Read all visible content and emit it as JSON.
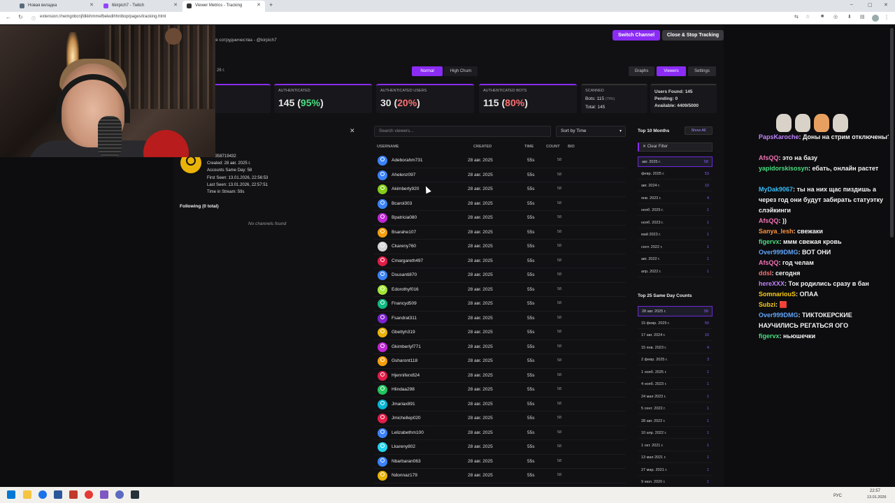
{
  "browser": {
    "tabs": [
      {
        "label": "Новая вкладка",
        "color": "#5a6a7a"
      },
      {
        "label": "6kirpich7 - Twitch",
        "color": "#9146ff"
      },
      {
        "label": "Viewer Metrics - Tracking",
        "color": "#333333"
      }
    ],
    "url": "extension://nemgnbcnjfdkkhmmefbeledihhnlbop/pages/tracking.html"
  },
  "header": {
    "channel_name": "6kirpich7",
    "channel_sub": "я сотрудничества - @kirpich7",
    "switch_label": "Switch Channel",
    "stop_label": "Close & Stop Tracking"
  },
  "toggles": {
    "normal": "Normal",
    "high_churn": "High Churn",
    "graphs": "Graphs",
    "viewers": "Viewers",
    "settings": "Settings",
    "left_truncated": "26 г."
  },
  "stats": {
    "authenticated": {
      "title": "AUTHENTICATED",
      "value": "145",
      "pct": "95%"
    },
    "auth_users": {
      "title": "AUTHENTICATED USERS",
      "value": "30",
      "pct": "20%"
    },
    "auth_bots": {
      "title": "AUTHENTICATED BOTS",
      "value": "115",
      "pct": "80%"
    },
    "scanned": {
      "title": "SCANNED",
      "bots": "Bots: 115",
      "bots_pct": "(79%)",
      "total": "Total: 145"
    },
    "users": {
      "found": "Users Found: 145",
      "pending": "Pending: 0",
      "available": "Available: 4409/5000"
    }
  },
  "detail": {
    "id": "Id: 1358719432",
    "created": "Created: 28 авг. 2025 г.",
    "same_day": "Accounts Same Day: 58",
    "first_seen": "First Seen: 13.01.2026, 22:56:53",
    "last_seen": "Last Seen: 13.01.2026, 22:57:51",
    "time_in_stream": "Time in Stream: 59s",
    "following": "Following (0 total)",
    "no_channels": "No channels found"
  },
  "viewers": {
    "search_placeholder": "Search viewers...",
    "sort_label": "Sort by Time",
    "columns": {
      "username": "USERNAME",
      "created": "CREATED",
      "time": "TIME",
      "count": "COUNT",
      "bio": "BIO"
    },
    "rows": [
      {
        "username": "Adeborahm731",
        "created": "28 авг. 2025",
        "time": "55s",
        "count": "58",
        "color": "#3b82f6"
      },
      {
        "username": "Ahelenz097",
        "created": "28 авг. 2025",
        "time": "55s",
        "count": "58",
        "color": "#3b82f6"
      },
      {
        "username": "Akimberly920",
        "created": "28 авг. 2025",
        "time": "55s",
        "count": "58",
        "color": "#84cc16"
      },
      {
        "username": "Bcarol303",
        "created": "28 авг. 2025",
        "time": "55s",
        "count": "58",
        "color": "#3b82f6"
      },
      {
        "username": "Bpatricia080",
        "created": "28 авг. 2025",
        "time": "55s",
        "count": "58",
        "color": "#c026d3"
      },
      {
        "username": "Bsarahe107",
        "created": "28 авг. 2025",
        "time": "55s",
        "count": "58",
        "color": "#f59e0b"
      },
      {
        "username": "Ckareny760",
        "created": "28 авг. 2025",
        "time": "55s",
        "count": "58",
        "color": "#d4d4d8"
      },
      {
        "username": "Cmargareth497",
        "created": "28 авг. 2025",
        "time": "55s",
        "count": "58",
        "color": "#e11d48"
      },
      {
        "username": "Dsusanti870",
        "created": "28 авг. 2025",
        "time": "55s",
        "count": "58",
        "color": "#3b82f6"
      },
      {
        "username": "Edorothyf016",
        "created": "28 авг. 2025",
        "time": "55s",
        "count": "58",
        "color": "#a3e635"
      },
      {
        "username": "Fnancyd509",
        "created": "28 авг. 2025",
        "time": "55s",
        "count": "58",
        "color": "#10b981"
      },
      {
        "username": "Fsandrat311",
        "created": "28 авг. 2025",
        "time": "55s",
        "count": "58",
        "color": "#7e22ce"
      },
      {
        "username": "Gbettyh319",
        "created": "28 авг. 2025",
        "time": "55s",
        "count": "58",
        "color": "#eab308"
      },
      {
        "username": "Gkimberlyf771",
        "created": "28 авг. 2025",
        "time": "55s",
        "count": "58",
        "color": "#c026d3"
      },
      {
        "username": "Gsharont118",
        "created": "28 авг. 2025",
        "time": "55s",
        "count": "58",
        "color": "#f59e0b"
      },
      {
        "username": "Hjenniferx824",
        "created": "28 авг. 2025",
        "time": "55s",
        "count": "58",
        "color": "#e11d48"
      },
      {
        "username": "Hlindaa298",
        "created": "28 авг. 2025",
        "time": "55s",
        "count": "58",
        "color": "#22c55e"
      },
      {
        "username": "Jmariax891",
        "created": "28 авг. 2025",
        "time": "55s",
        "count": "58",
        "color": "#06b6d4"
      },
      {
        "username": "Jmichellep020",
        "created": "28 авг. 2025",
        "time": "55s",
        "count": "58",
        "color": "#e11d48"
      },
      {
        "username": "Lelizabethm100",
        "created": "28 авг. 2025",
        "time": "55s",
        "count": "58",
        "color": "#3b82f6"
      },
      {
        "username": "Lkareny802",
        "created": "28 авг. 2025",
        "time": "55s",
        "count": "58",
        "color": "#22d3ee"
      },
      {
        "username": "Nbarbaran063",
        "created": "28 авг. 2025",
        "time": "55s",
        "count": "58",
        "color": "#3b82f6"
      },
      {
        "username": "Ndonnaz179",
        "created": "28 авг. 2025",
        "time": "55s",
        "count": "58",
        "color": "#eab308"
      }
    ]
  },
  "top_months": {
    "title": "Top 10 Months",
    "show_all": "Show All",
    "clear_filter": "✕ Clear Filter",
    "items": [
      {
        "label": "авг. 2025 г.",
        "count": "58",
        "selected": true
      },
      {
        "label": "февр. 2025 г.",
        "count": "53"
      },
      {
        "label": "авг. 2024 г.",
        "count": "10"
      },
      {
        "label": "янв. 2023 г.",
        "count": "4"
      },
      {
        "label": "нояб. 2025 г.",
        "count": "1"
      },
      {
        "label": "нояб. 2023 г.",
        "count": "1"
      },
      {
        "label": "май 2023 г.",
        "count": "1"
      },
      {
        "label": "сент. 2022 г.",
        "count": "1"
      },
      {
        "label": "авг. 2022 г.",
        "count": "1"
      },
      {
        "label": "апр. 2022 г.",
        "count": "1"
      }
    ]
  },
  "top_same_day": {
    "title": "Top 25 Same Day Counts",
    "items": [
      {
        "label": "28 авг. 2025 г.",
        "count": "58",
        "selected": true
      },
      {
        "label": "15 февр. 2025 г.",
        "count": "50"
      },
      {
        "label": "17 авг. 2024 г.",
        "count": "10"
      },
      {
        "label": "15 янв. 2023 г.",
        "count": "4"
      },
      {
        "label": "2 февр. 2025 г.",
        "count": "3"
      },
      {
        "label": "1 нояб. 2025 г.",
        "count": "1"
      },
      {
        "label": "4 нояб. 2023 г.",
        "count": "1"
      },
      {
        "label": "24 мая 2023 г.",
        "count": "1"
      },
      {
        "label": "5 сент. 2022 г.",
        "count": "1"
      },
      {
        "label": "28 авг. 2022 г.",
        "count": "1"
      },
      {
        "label": "10 апр. 2022 г.",
        "count": "1"
      },
      {
        "label": "1 окт. 2021 г.",
        "count": "1"
      },
      {
        "label": "13 мая 2021 г.",
        "count": "1"
      },
      {
        "label": "27 мар. 2021 г.",
        "count": "1"
      },
      {
        "label": "9 июл. 2020 г.",
        "count": "1"
      }
    ]
  },
  "chat": [
    {
      "user": "PapsKaroche",
      "color": "#c084fc",
      "text": "Доны на стрим отключены?"
    },
    {
      "user": "AfsQQ",
      "color": "#f472b6",
      "text": "это на базу"
    },
    {
      "user": "yapidorskisosyn",
      "color": "#4ade80",
      "text": "ебать, онлайн растет"
    },
    {
      "user": "MyDak9067",
      "color": "#38bdf8",
      "text": "ты на них щас пиздишь а через год они будут забирать статуэтку слэйкинги"
    },
    {
      "user": "AfsQQ",
      "color": "#f472b6",
      "text": "))"
    },
    {
      "user": "Sanya_lesh",
      "color": "#fb923c",
      "text": "свежаки"
    },
    {
      "user": "figervx",
      "color": "#4ade80",
      "text": "ммм свежая кровь"
    },
    {
      "user": "Over999DMG",
      "color": "#60a5fa",
      "text": "ВОТ ОНИ"
    },
    {
      "user": "AfsQQ",
      "color": "#f472b6",
      "text": "год челам"
    },
    {
      "user": "ddsl",
      "color": "#f87171",
      "text": "сегодня"
    },
    {
      "user": "hereXXX",
      "color": "#c084fc",
      "text": "Ток родились сразу в бан"
    },
    {
      "user": "SomnariouS",
      "color": "#facc15",
      "text": "ОПАА"
    },
    {
      "user": "Subzi",
      "color": "#facc15",
      "text": "🟥"
    },
    {
      "user": "Over999DMG",
      "color": "#60a5fa",
      "text": "ТИКТОКЕРСКИЕ НАУЧИЛИСЬ РЕГАТЬСЯ ОГО"
    },
    {
      "user": "figervx",
      "color": "#4ade80",
      "text": "ньюшечки"
    }
  ],
  "taskbar": {
    "lang": "РУС",
    "time": "22:57",
    "date": "13.01.2026"
  },
  "colors": {
    "accent": "#8b2cf5",
    "green": "#4ade80",
    "red": "#f87171"
  }
}
